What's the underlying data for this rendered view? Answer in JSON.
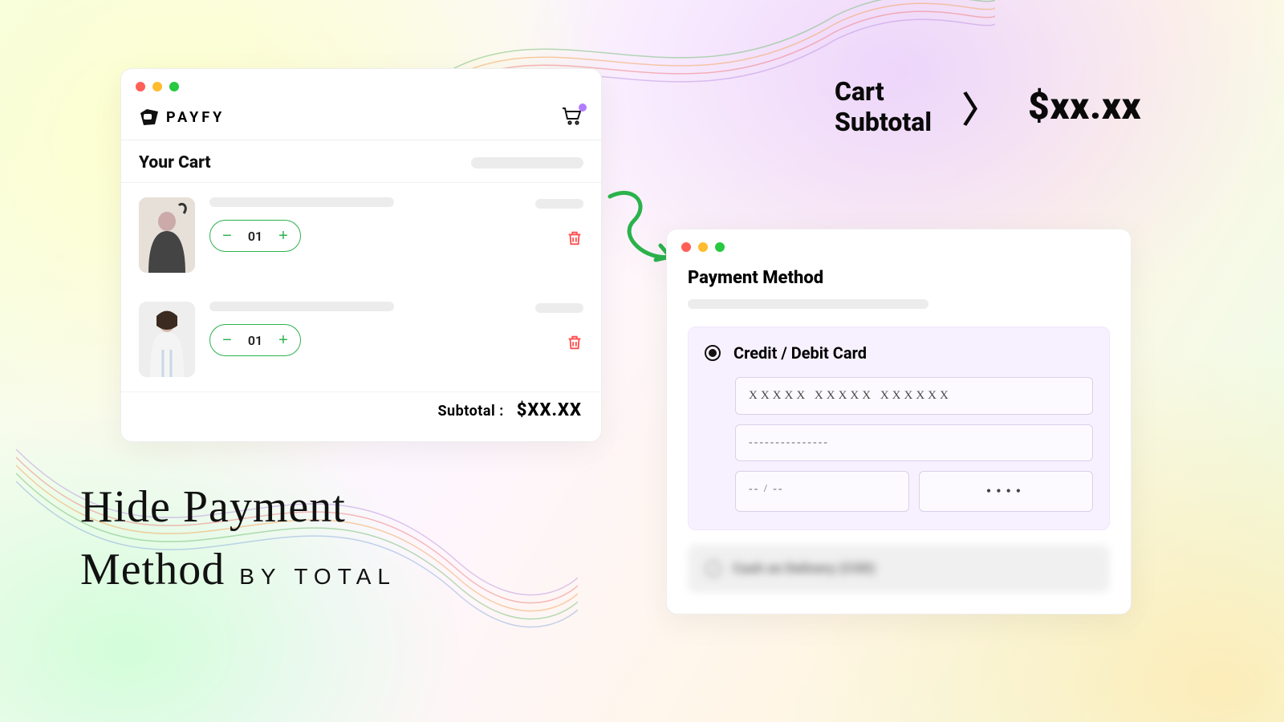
{
  "brand": {
    "name": "PAYFY"
  },
  "cart": {
    "title": "Your Cart",
    "items": [
      {
        "qty": "01"
      },
      {
        "qty": "01"
      }
    ],
    "subtotal_label": "Subtotal :",
    "subtotal_amount": "$XX.XX"
  },
  "payment": {
    "title": "Payment Method",
    "credit_label": "Credit / Debit Card",
    "card_number": "XXXXX  XXXXX  XXXXXX",
    "card_name": "---------------",
    "card_exp": "-- / --",
    "card_cvv": "••••",
    "hidden_label": "Cash on Delivery (COD)"
  },
  "condition": {
    "label_line1": "Cart",
    "label_line2": "Subtotal",
    "operator": "〉",
    "amount": "$xx.xx"
  },
  "headline": {
    "line1": "Hide Payment",
    "line2a": "Method",
    "line2b": "BY TOTAL"
  }
}
